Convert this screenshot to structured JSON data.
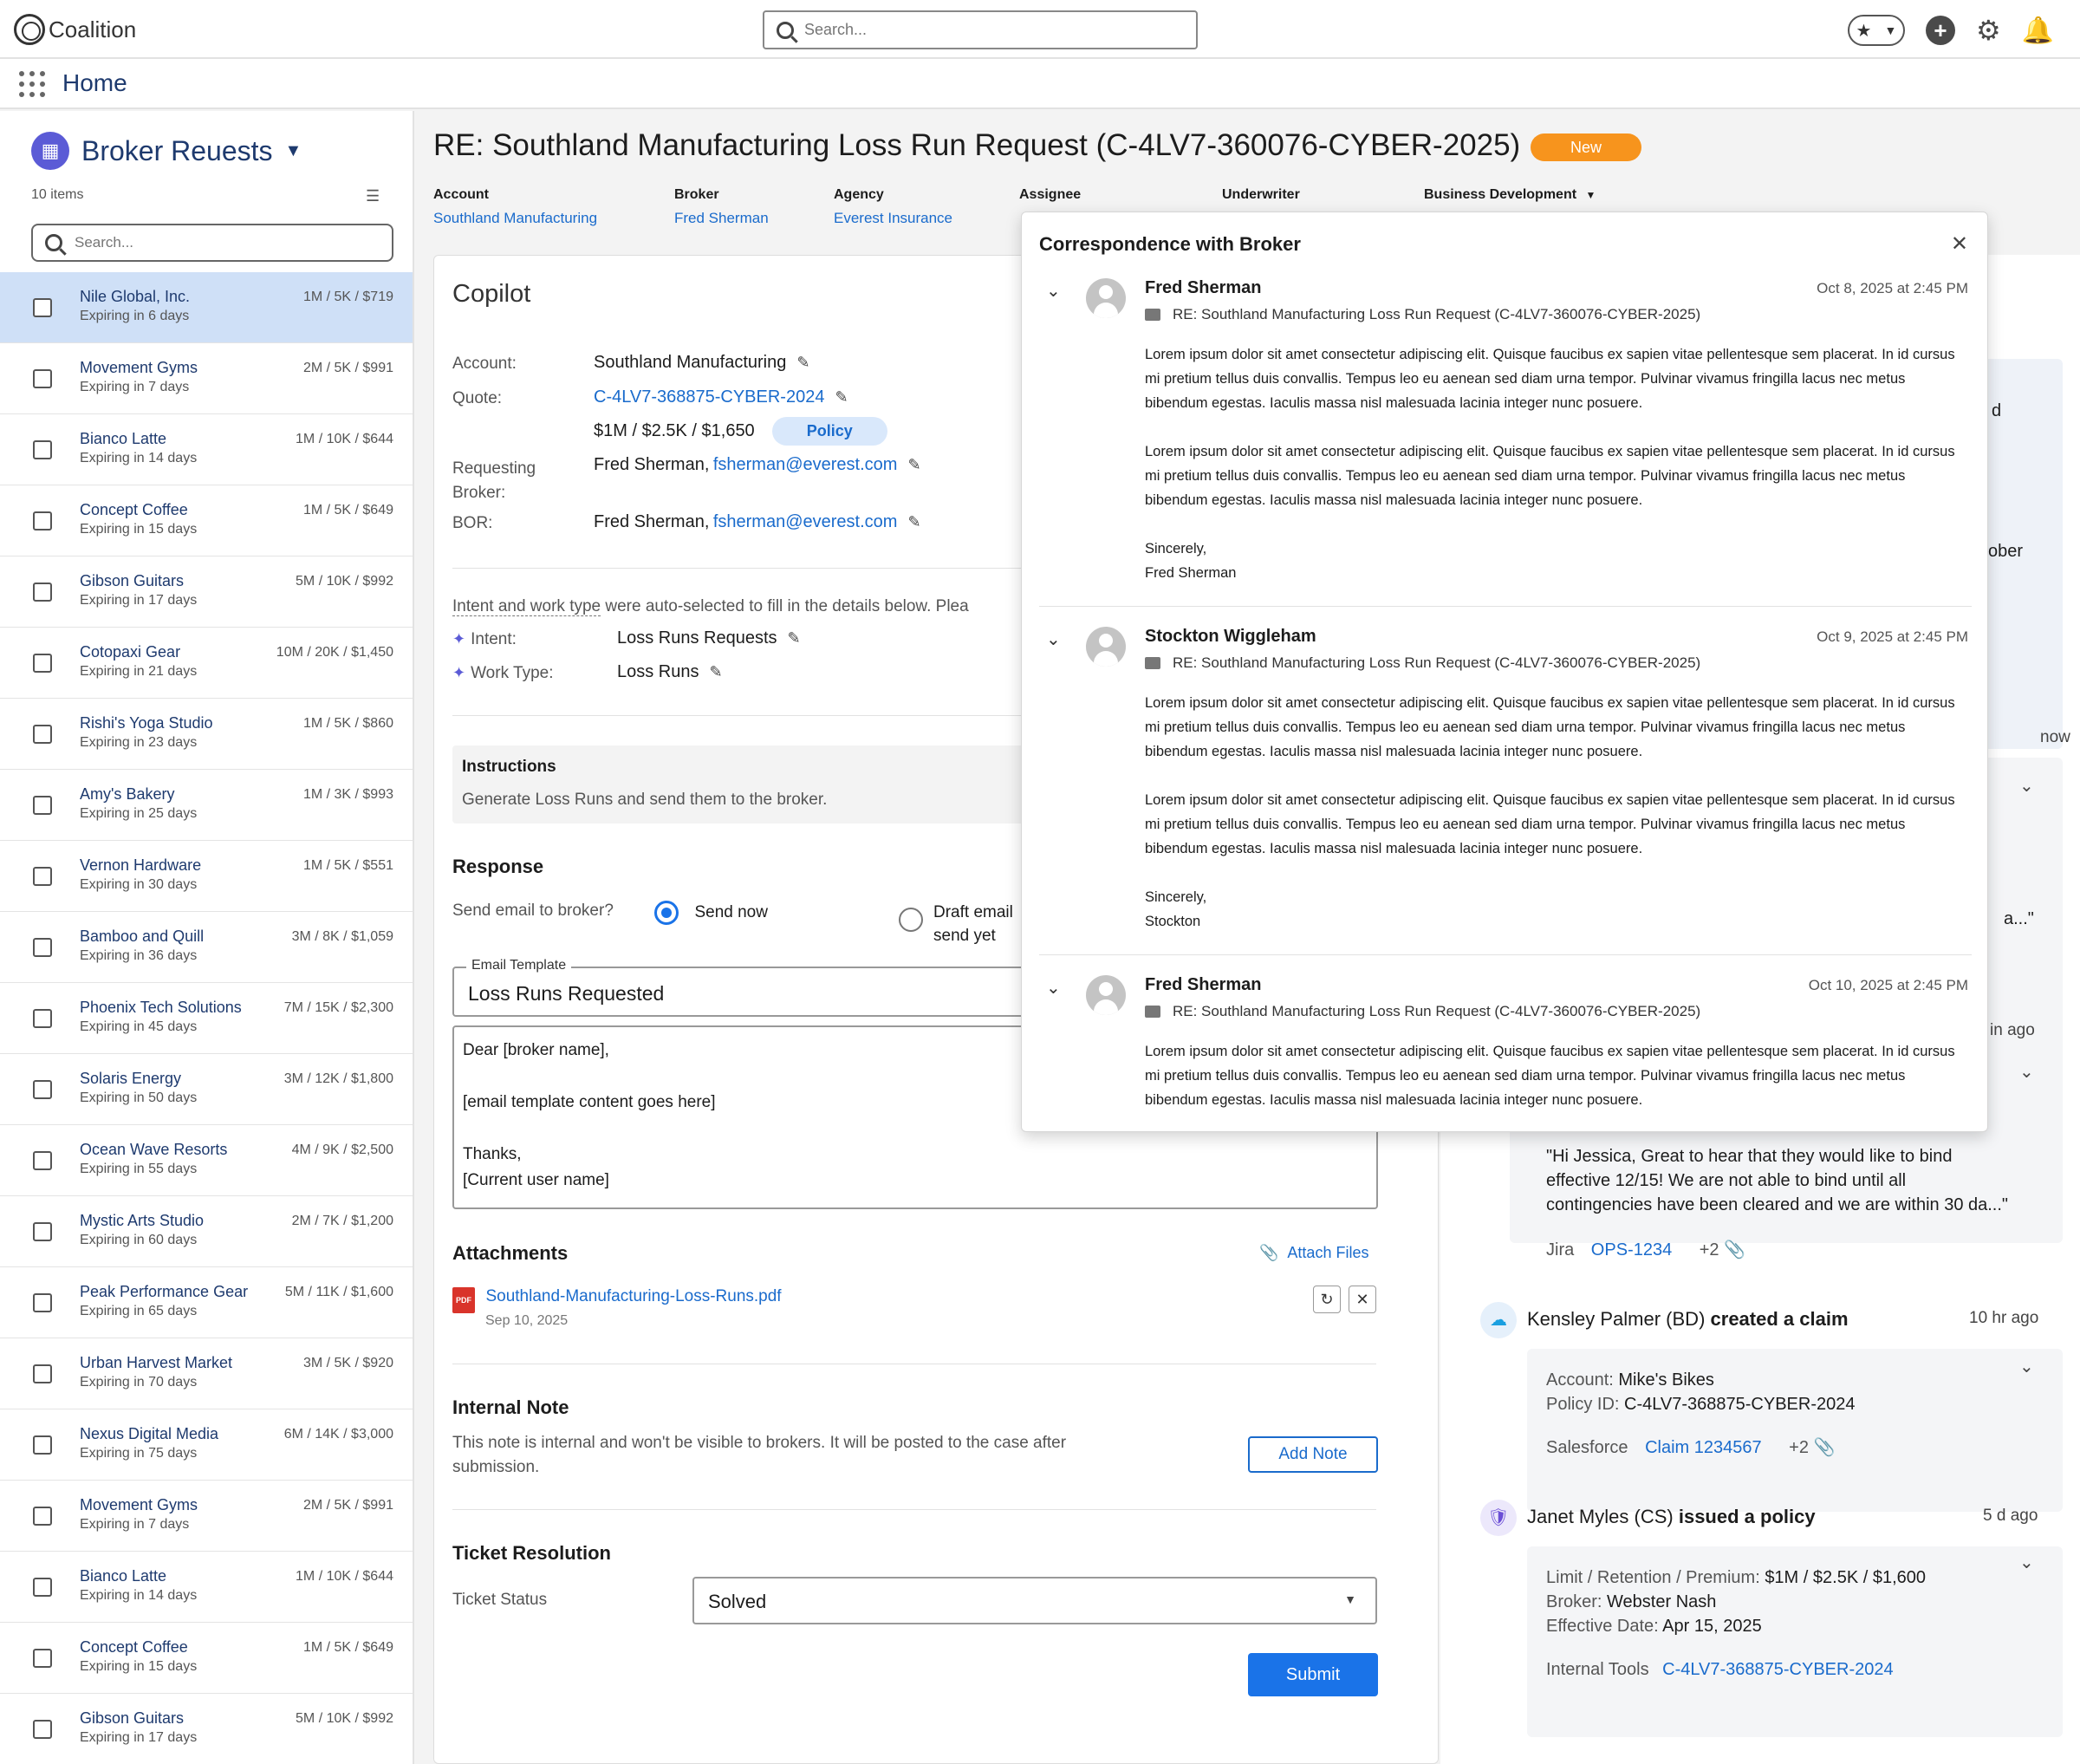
{
  "topbar": {
    "logo_text": "Coalition",
    "search_placeholder": "Search...",
    "icons": [
      "star-icon",
      "chevron-down-icon",
      "plus-icon",
      "gear-icon",
      "bell-icon"
    ]
  },
  "nav": {
    "title": "Home"
  },
  "sidebar": {
    "title": "Broker Reuests",
    "count": "10 items",
    "search_placeholder": "Search...",
    "items": [
      {
        "name": "Nile Global, Inc.",
        "expiry": "Expiring in 6 days",
        "pricing": "1M / 5K / $719",
        "selected": true
      },
      {
        "name": "Movement Gyms",
        "expiry": "Expiring in 7 days",
        "pricing": "2M / 5K / $991"
      },
      {
        "name": "Bianco Latte",
        "expiry": "Expiring in 14 days",
        "pricing": "1M / 10K / $644"
      },
      {
        "name": "Concept Coffee",
        "expiry": "Expiring in 15 days",
        "pricing": "1M / 5K / $649"
      },
      {
        "name": "Gibson Guitars",
        "expiry": "Expiring in 17 days",
        "pricing": "5M / 10K / $992"
      },
      {
        "name": "Cotopaxi Gear",
        "expiry": "Expiring in 21 days",
        "pricing": "10M / 20K / $1,450"
      },
      {
        "name": "Rishi's Yoga Studio",
        "expiry": "Expiring in 23 days",
        "pricing": "1M / 5K / $860"
      },
      {
        "name": "Amy's Bakery",
        "expiry": "Expiring in 25 days",
        "pricing": "1M / 3K / $993"
      },
      {
        "name": "Vernon Hardware",
        "expiry": "Expiring in 30 days",
        "pricing": "1M / 5K / $551"
      },
      {
        "name": "Bamboo and Quill",
        "expiry": "Expiring in 36 days",
        "pricing": "3M / 8K / $1,059"
      },
      {
        "name": "Phoenix Tech Solutions",
        "expiry": "Expiring in 45 days",
        "pricing": "7M / 15K / $2,300"
      },
      {
        "name": "Solaris Energy",
        "expiry": "Expiring in 50 days",
        "pricing": "3M / 12K / $1,800"
      },
      {
        "name": "Ocean Wave Resorts",
        "expiry": "Expiring in 55 days",
        "pricing": "4M / 9K / $2,500"
      },
      {
        "name": "Mystic Arts Studio",
        "expiry": "Expiring in 60 days",
        "pricing": "2M / 7K / $1,200"
      },
      {
        "name": "Peak Performance Gear",
        "expiry": "Expiring in 65 days",
        "pricing": "5M / 11K / $1,600"
      },
      {
        "name": "Urban Harvest Market",
        "expiry": "Expiring in 70 days",
        "pricing": "3M / 5K / $920"
      },
      {
        "name": "Nexus Digital Media",
        "expiry": "Expiring in 75 days",
        "pricing": "6M / 14K / $3,000"
      },
      {
        "name": "Movement Gyms",
        "expiry": "Expiring in 7 days",
        "pricing": "2M / 5K / $991"
      },
      {
        "name": "Bianco Latte",
        "expiry": "Expiring in 14 days",
        "pricing": "1M / 10K / $644"
      },
      {
        "name": "Concept Coffee",
        "expiry": "Expiring in 15 days",
        "pricing": "1M / 5K / $649"
      },
      {
        "name": "Gibson Guitars",
        "expiry": "Expiring in 17 days",
        "pricing": "5M / 10K / $992"
      }
    ]
  },
  "case": {
    "title": "RE: Southland Manufacturing Loss Run Request (C-4LV7-360076-CYBER-2025)",
    "status_badge": "New",
    "status_color": "#f7941d",
    "meta": {
      "account_label": "Account",
      "account_value": "Southland Manufacturing",
      "broker_label": "Broker",
      "broker_value": "Fred Sherman",
      "agency_label": "Agency",
      "agency_value": "Everest Insurance",
      "assignee_label": "Assignee",
      "underwriter_label": "Underwriter",
      "bd_label": "Business Development"
    }
  },
  "copilot": {
    "title": "Copilot",
    "account_label": "Account:",
    "account_value": "Southland Manufacturing",
    "quote_label": "Quote:",
    "quote_value": "C-4LV7-368875-CYBER-2024",
    "quote_terms": "$1M / $2.5K / $1,650",
    "policy_pill": "Policy",
    "requesting_label_1": "Requesting",
    "requesting_label_2": "Broker:",
    "requesting_name": "Fred Sherman,",
    "requesting_email": "fsherman@everest.com",
    "bor_label": "BOR:",
    "bor_name": "Fred Sherman,",
    "bor_email": "fsherman@everest.com",
    "auto_note_link": "Intent and work type",
    "auto_note_rest": "were auto-selected to fill in the details below. Plea",
    "intent_label": "Intent:",
    "intent_value": "Loss Runs Requests",
    "worktype_label": "Work Type:",
    "worktype_value": "Loss Runs",
    "instructions_title": "Instructions",
    "instructions_text": "Generate Loss Runs and send them to the broker.",
    "response_title": "Response",
    "send_question": "Send email to broker?",
    "send_now": "Send now",
    "draft_line1": "Draft email",
    "draft_line2": "send yet",
    "template_label": "Email Template",
    "template_value": "Loss Runs Requested",
    "email_lines": [
      "Dear [broker name],",
      "",
      "[email template content goes here]",
      "",
      "Thanks,",
      "[Current user name]"
    ],
    "attachments_title": "Attachments",
    "attach_files": "Attach Files",
    "file_name": "Southland-Manufacturing-Loss-Runs.pdf",
    "file_date": "Sep 10, 2025",
    "internal_note_title": "Internal Note",
    "internal_note_text_1": "This note is internal and won't be visible to brokers. It will be posted to the case after",
    "internal_note_text_2": "submission.",
    "add_note": "Add Note",
    "resolution_title": "Ticket Resolution",
    "ticket_status_label": "Ticket Status",
    "ticket_status_value": "Solved",
    "submit": "Submit",
    "accent": "#1a73e8"
  },
  "activity": {
    "frag_d": "d",
    "frag_ober": "ober",
    "frag_now": "now",
    "frag_a": "a...\"",
    "frag_in_ago": "in ago",
    "quote_text": [
      "\"Hi Jessica, Great to hear that they would like to bind",
      "effective 12/15! We are not able to bind until all",
      "contingencies have been cleared and we are within 30 da...\""
    ],
    "jira_label": "Jira",
    "jira_link": "OPS-1234",
    "jira_more": "+2",
    "claim_actor": "Kensley Palmer (BD)",
    "claim_action": "created a claim",
    "claim_time": "10 hr ago",
    "claim_account_label": "Account:",
    "claim_account_value": "Mike's Bikes",
    "claim_policy_label": "Policy ID:",
    "claim_policy_value": "C-4LV7-368875-CYBER-2024",
    "sf_label": "Salesforce",
    "sf_link": "Claim 1234567",
    "sf_more": "+2",
    "policy_actor": "Janet Myles (CS)",
    "policy_action": "issued a policy",
    "policy_time": "5 d ago",
    "lrp_label": "Limit / Retention / Premium:",
    "lrp_value": "$1M / $2.5K / $1,600",
    "broker_label": "Broker:",
    "broker_value": "Webster Nash",
    "eff_label": "Effective Date:",
    "eff_value": "Apr 15, 2025",
    "tools_label": "Internal Tools",
    "tools_link": "C-4LV7-368875-CYBER-2024"
  },
  "correspondence": {
    "title": "Correspondence with Broker",
    "messages": [
      {
        "sender": "Fred Sherman",
        "date": "Oct 8, 2025 at 2:45 PM",
        "subject": "RE: Southland Manufacturing Loss Run Request (C-4LV7-360076-CYBER-2025)",
        "paragraphs": [
          "Lorem ipsum dolor sit amet consectetur adipiscing elit. Quisque faucibus ex sapien vitae pellentesque sem placerat. In id cursus mi pretium tellus duis convallis. Tempus leo eu aenean sed diam urna tempor. Pulvinar vivamus fringilla lacus nec metus bibendum egestas. Iaculis massa nisl malesuada lacinia integer nunc posuere.",
          "Lorem ipsum dolor sit amet consectetur adipiscing elit. Quisque faucibus ex sapien vitae pellentesque sem placerat. In id cursus mi pretium tellus duis convallis. Tempus leo eu aenean sed diam urna tempor. Pulvinar vivamus fringilla lacus nec metus bibendum egestas. Iaculis massa nisl malesuada lacinia integer nunc posuere."
        ],
        "signoff": "Sincerely,",
        "signature": "Fred Sherman"
      },
      {
        "sender": "Stockton Wiggleham",
        "date": "Oct 9, 2025 at 2:45 PM",
        "subject": "RE: Southland Manufacturing Loss Run Request (C-4LV7-360076-CYBER-2025)",
        "paragraphs": [
          "Lorem ipsum dolor sit amet consectetur adipiscing elit. Quisque faucibus ex sapien vitae pellentesque sem placerat. In id cursus mi pretium tellus duis convallis. Tempus leo eu aenean sed diam urna tempor. Pulvinar vivamus fringilla lacus nec metus bibendum egestas. Iaculis massa nisl malesuada lacinia integer nunc posuere.",
          "Lorem ipsum dolor sit amet consectetur adipiscing elit. Quisque faucibus ex sapien vitae pellentesque sem placerat. In id cursus mi pretium tellus duis convallis. Tempus leo eu aenean sed diam urna tempor. Pulvinar vivamus fringilla lacus nec metus bibendum egestas. Iaculis massa nisl malesuada lacinia integer nunc posuere."
        ],
        "signoff": "Sincerely,",
        "signature": "Stockton"
      },
      {
        "sender": "Fred Sherman",
        "date": "Oct 10, 2025 at 2:45 PM",
        "subject": "RE: Southland Manufacturing Loss Run Request (C-4LV7-360076-CYBER-2025)",
        "paragraphs": [
          "Lorem ipsum dolor sit amet consectetur adipiscing elit. Quisque faucibus ex sapien vitae pellentesque sem placerat. In id cursus mi pretium tellus duis convallis. Tempus leo eu aenean sed diam urna tempor. Pulvinar vivamus fringilla lacus nec metus bibendum egestas. Iaculis massa nisl malesuada lacinia integer nunc posuere."
        ]
      }
    ]
  }
}
